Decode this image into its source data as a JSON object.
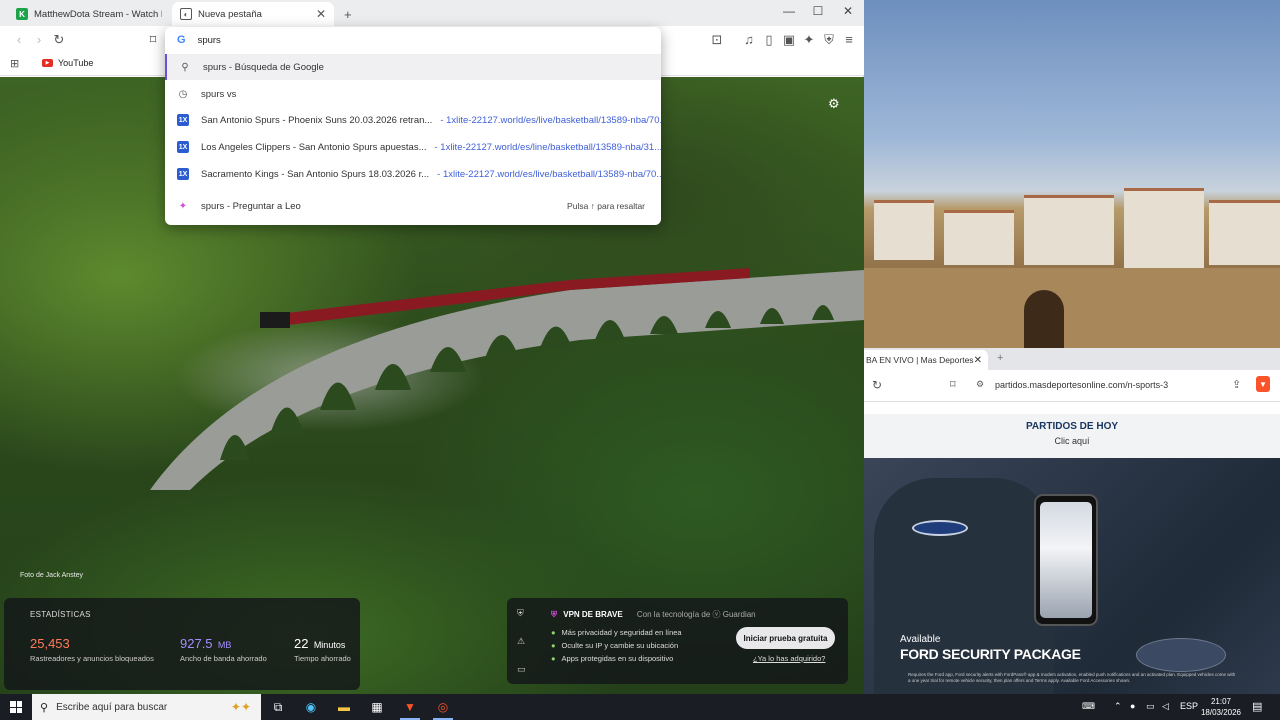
{
  "browser_left": {
    "tabs": [
      {
        "title": "MatthewDota Stream - Watch Live or..."
      },
      {
        "title": "Nueva pestaña"
      }
    ],
    "new_tab": "+",
    "bookmarks": [
      {
        "label": "YouTube"
      }
    ]
  },
  "omnibox": {
    "query": "spurs",
    "suggestions": [
      {
        "text": "spurs - Búsqueda de Google",
        "url": "",
        "hint": ""
      },
      {
        "text": "spurs vs",
        "url": "",
        "hint": ""
      },
      {
        "text": "San Antonio Spurs - Phoenix Suns 20.03.2026 retran...",
        "url": "- 1xlite-22127.world/es/live/basketball/13589-nba/70...",
        "hint": ""
      },
      {
        "text": "Los Angeles Clippers - San Antonio Spurs apuestas...",
        "url": "- 1xlite-22127.world/es/line/basketball/13589-nba/31...",
        "hint": ""
      },
      {
        "text": "Sacramento Kings - San Antonio Spurs 18.03.2026 r...",
        "url": "- 1xlite-22127.world/es/live/basketball/13589-nba/70...",
        "hint": ""
      },
      {
        "text": "spurs - Preguntar a Leo",
        "url": "",
        "hint": "Pulsa ↑ para resaltar"
      }
    ]
  },
  "photo_credit": "Foto de Jack Anstey",
  "stats": {
    "title": "ESTADÍSTICAS",
    "items": [
      {
        "value": "25,453",
        "unit": "",
        "label": "Rastreadores y anuncios bloqueados",
        "color": "#ff7a5c"
      },
      {
        "value": "927.5",
        "unit": "MB",
        "label": "Ancho de banda ahorrado",
        "color": "#a48dff"
      },
      {
        "value": "22",
        "unit": "Minutos",
        "label": "Tiempo ahorrado",
        "color": "#ffffff"
      }
    ]
  },
  "vpn": {
    "title": "VPN DE BRAVE",
    "subtitle": "Con la tecnología de ⓥ Guardian",
    "bullets": [
      "Más privacidad y seguridad en línea",
      "Oculte su IP y cambie su ubicación",
      "Apps protegidas en su dispositivo"
    ],
    "button": "Iniciar prueba gratuita",
    "link": "¿Ya lo has adquirido?"
  },
  "browser_right": {
    "tab_title": "BA EN VIVO | Mas Deportes",
    "url": "partidos.masdeportesonline.com/n-sports-3",
    "page_heading": "PARTIDOS DE HOY",
    "page_sub": "Clic aquí",
    "ad": {
      "available": "Available",
      "headline": "FORD SECURITY PACKAGE",
      "fine_print": "Requires the Ford app, Ford security alerts with FordPass® app & modem activation, enabled push notifications and an activated plan. Equipped vehicles come with a one year trial for remote vehicle security, then plan offers and Terms apply. Available Ford Accessories shown."
    }
  },
  "taskbar": {
    "search_placeholder": "Escribe aquí para buscar",
    "language": "ESP",
    "time": "21:07",
    "date": "18/03/2026"
  },
  "colors": {
    "accent": "#6b4fd8",
    "link": "#3f5fd8",
    "brave": "#fb542b"
  }
}
